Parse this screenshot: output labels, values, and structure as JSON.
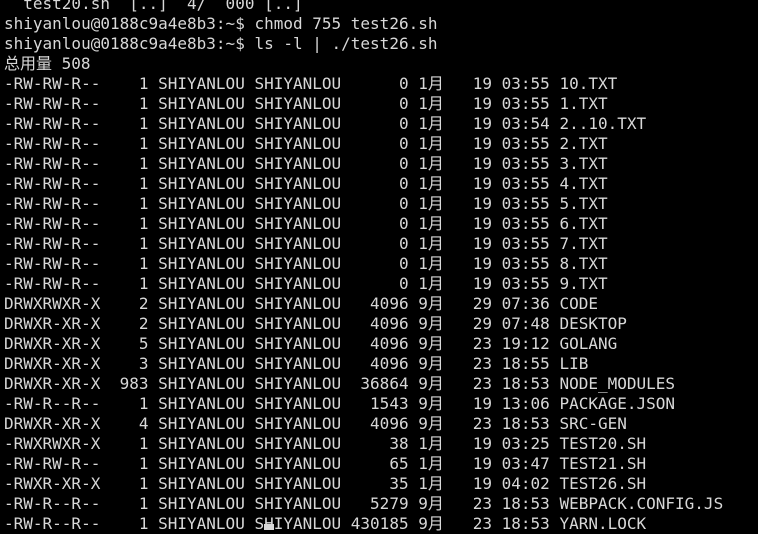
{
  "terminal": {
    "lines": [
      {
        "text": "  test20.sh  [..]  4/  000 [..]"
      },
      {
        "text": "shiyanlou@0188c9a4e8b3:~$ chmod 755 test26.sh"
      },
      {
        "text": "shiyanlou@0188c9a4e8b3:~$ ls -l | ./test26.sh"
      },
      {
        "text": "总用量 508"
      },
      {
        "text": "-RW-RW-R--    1 SHIYANLOU SHIYANLOU      0 1月   19 03:55 10.TXT"
      },
      {
        "text": "-RW-RW-R--    1 SHIYANLOU SHIYANLOU      0 1月   19 03:55 1.TXT"
      },
      {
        "text": "-RW-RW-R--    1 SHIYANLOU SHIYANLOU      0 1月   19 03:54 2..10.TXT"
      },
      {
        "text": "-RW-RW-R--    1 SHIYANLOU SHIYANLOU      0 1月   19 03:55 2.TXT"
      },
      {
        "text": "-RW-RW-R--    1 SHIYANLOU SHIYANLOU      0 1月   19 03:55 3.TXT"
      },
      {
        "text": "-RW-RW-R--    1 SHIYANLOU SHIYANLOU      0 1月   19 03:55 4.TXT"
      },
      {
        "text": "-RW-RW-R--    1 SHIYANLOU SHIYANLOU      0 1月   19 03:55 5.TXT"
      },
      {
        "text": "-RW-RW-R--    1 SHIYANLOU SHIYANLOU      0 1月   19 03:55 6.TXT"
      },
      {
        "text": "-RW-RW-R--    1 SHIYANLOU SHIYANLOU      0 1月   19 03:55 7.TXT"
      },
      {
        "text": "-RW-RW-R--    1 SHIYANLOU SHIYANLOU      0 1月   19 03:55 8.TXT"
      },
      {
        "text": "-RW-RW-R--    1 SHIYANLOU SHIYANLOU      0 1月   19 03:55 9.TXT"
      },
      {
        "text": "DRWXRWXR-X    2 SHIYANLOU SHIYANLOU   4096 9月   29 07:36 CODE"
      },
      {
        "text": "DRWXR-XR-X    2 SHIYANLOU SHIYANLOU   4096 9月   29 07:48 DESKTOP"
      },
      {
        "text": "DRWXR-XR-X    5 SHIYANLOU SHIYANLOU   4096 9月   23 19:12 GOLANG"
      },
      {
        "text": "DRWXR-XR-X    3 SHIYANLOU SHIYANLOU   4096 9月   23 18:55 LIB"
      },
      {
        "text": "DRWXR-XR-X  983 SHIYANLOU SHIYANLOU  36864 9月   23 18:53 NODE_MODULES"
      },
      {
        "text": "-RW-R--R--    1 SHIYANLOU SHIYANLOU   1543 9月   19 13:06 PACKAGE.JSON"
      },
      {
        "text": "DRWXR-XR-X    4 SHIYANLOU SHIYANLOU   4096 9月   23 18:53 SRC-GEN"
      },
      {
        "text": "-RWXRWXR-X    1 SHIYANLOU SHIYANLOU     38 1月   19 03:25 TEST20.SH"
      },
      {
        "text": "-RW-RW-R--    1 SHIYANLOU SHIYANLOU     65 1月   19 03:47 TEST21.SH"
      },
      {
        "text": "-RWXR-XR-X    1 SHIYANLOU SHIYANLOU     35 1月   19 04:02 TEST26.SH"
      },
      {
        "text": "-RW-R--R--    1 SHIYANLOU SHIYANLOU   5279 9月   23 18:53 WEBPACK.CONFIG.JS"
      },
      {
        "text": "-RW-R--R--    1 SHIYANLOU SHIYANLOU 430185 9月   23 18:53 YARN.LOCK"
      }
    ]
  },
  "colors": {
    "background": "#000000",
    "foreground": "#d8d8d8"
  }
}
